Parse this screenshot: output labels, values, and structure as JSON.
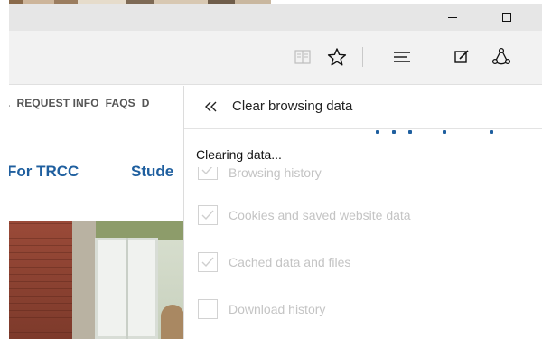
{
  "icons": {
    "minimize": "minimize-icon",
    "maximize": "maximize-icon",
    "reading_view": "book-icon",
    "favorites": "star-icon",
    "hub": "hub-icon",
    "web_note": "note-icon",
    "share": "share-icon",
    "more": "more-icon",
    "back": "double-chevron-left-icon"
  },
  "webpage": {
    "nav": [
      "REQUEST INFO",
      "FAQS",
      "D"
    ],
    "nav_prefix": ".",
    "links": [
      "For TRCC",
      "Stude"
    ],
    "link_color": "#1f5f9f"
  },
  "panel": {
    "title": "Clear browsing data",
    "status": "Clearing data...",
    "options": [
      {
        "label": "Browsing history",
        "checked": true
      },
      {
        "label": "Cookies and saved website data",
        "checked": true
      },
      {
        "label": "Cached data and files",
        "checked": true
      },
      {
        "label": "Download history",
        "checked": false
      }
    ]
  },
  "colors": {
    "titlebar": "#e6e6e6",
    "toolbar": "#f2f2f2",
    "disabled_text": "#c4c4c4"
  }
}
